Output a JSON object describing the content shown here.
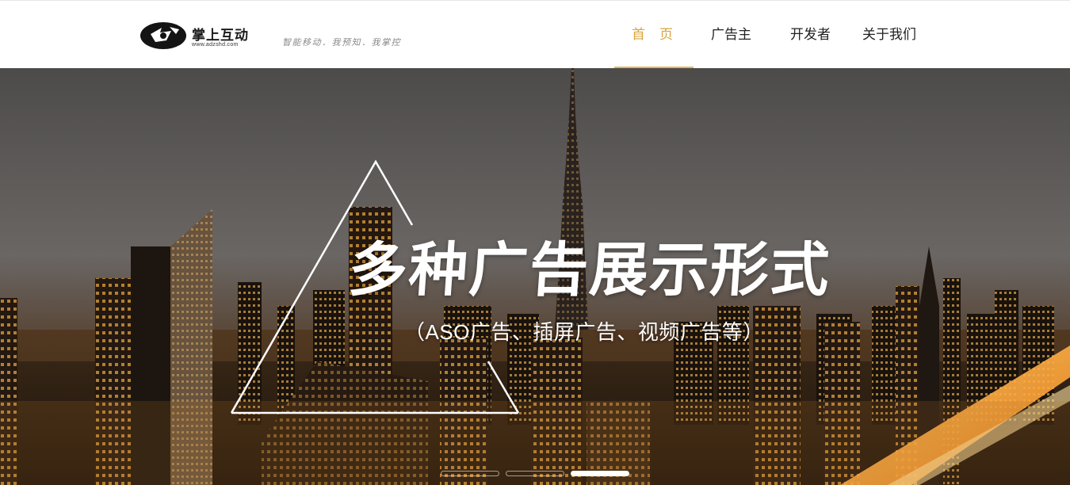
{
  "header": {
    "logo": {
      "name": "掌上互动",
      "url": "www.adzshd.com"
    },
    "slogan": "智能移动．我预知．我掌控",
    "nav": [
      {
        "label": "首页",
        "active": true
      },
      {
        "label": "广告主",
        "active": false
      },
      {
        "label": "开发者",
        "active": false
      },
      {
        "label": "关于我们",
        "active": false
      }
    ]
  },
  "banner": {
    "headline": "多种广告展示形式",
    "subline": "（ASO广告、插屏广告、视频广告等）",
    "carousel": {
      "slides": 3,
      "active_index": 2
    }
  },
  "colors": {
    "accent": "#e4b65a",
    "nav_active_text": "#d9a441",
    "text": "#222222"
  }
}
